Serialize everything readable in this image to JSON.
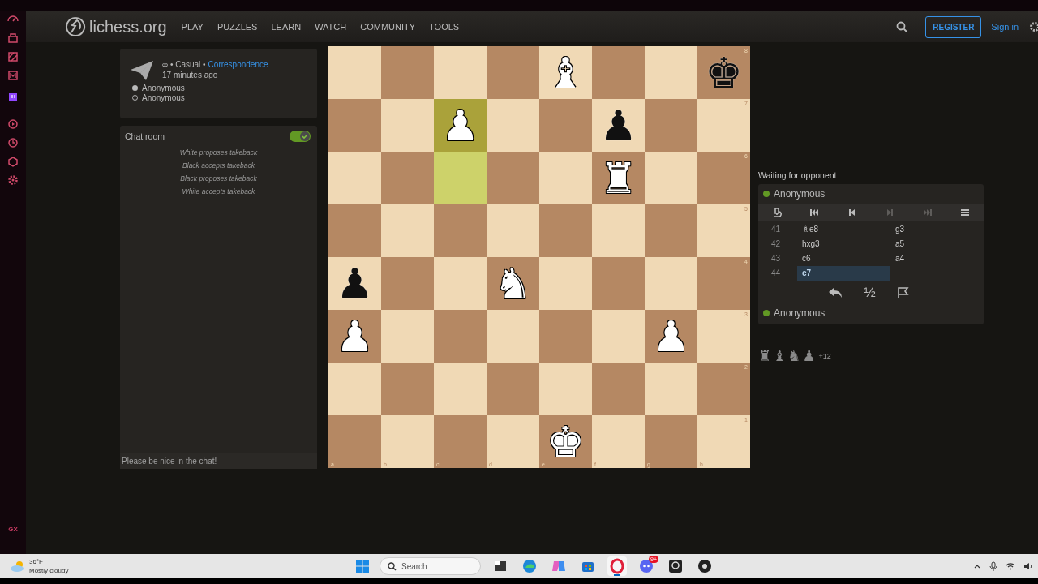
{
  "browser_sidebar": {
    "label": "GX",
    "more": "..."
  },
  "header": {
    "logo": "lichess.org",
    "nav": [
      "PLAY",
      "PUZZLES",
      "LEARN",
      "WATCH",
      "COMMUNITY",
      "TOOLS"
    ],
    "register": "REGISTER",
    "sign_in": "Sign in"
  },
  "game_info": {
    "speed": "∞ • Casual •",
    "variant_link": "Correspondence",
    "time": "17 minutes ago",
    "players": [
      {
        "name": "Anonymous",
        "kind": "white"
      },
      {
        "name": "Anonymous",
        "kind": "black"
      }
    ]
  },
  "chat": {
    "title": "Chat room",
    "on": true,
    "messages": [
      "White proposes takeback",
      "Black accepts takeback",
      "Black proposes takeback",
      "White accepts takeback"
    ],
    "placeholder": "Please be nice in the chat!"
  },
  "board": {
    "files": [
      "a",
      "b",
      "c",
      "d",
      "e",
      "f",
      "g",
      "h"
    ],
    "ranks": [
      "8",
      "7",
      "6",
      "5",
      "4",
      "3",
      "2",
      "1"
    ],
    "rows": [
      [
        {
          "highlighted": false
        },
        {
          "highlighted": false
        },
        {
          "highlighted": false
        },
        {
          "highlighted": false
        },
        {
          "highlighted": false,
          "piece": "♝",
          "kind": "white"
        },
        {
          "highlighted": false
        },
        {
          "highlighted": false
        },
        {
          "highlighted": false,
          "piece": "♚",
          "kind": "black"
        }
      ],
      [
        {
          "highlighted": false
        },
        {
          "highlighted": false
        },
        {
          "highlighted": true,
          "piece": "♟",
          "kind": "white"
        },
        {
          "highlighted": false
        },
        {
          "highlighted": false
        },
        {
          "highlighted": false,
          "piece": "♟",
          "kind": "black"
        },
        {
          "highlighted": false
        },
        {
          "highlighted": false
        }
      ],
      [
        {
          "highlighted": false
        },
        {
          "highlighted": false
        },
        {
          "highlighted": true
        },
        {
          "highlighted": false
        },
        {
          "highlighted": false
        },
        {
          "highlighted": false,
          "piece": "♜",
          "kind": "white"
        },
        {
          "highlighted": false
        },
        {
          "highlighted": false
        }
      ],
      [
        {
          "highlighted": false
        },
        {
          "highlighted": false
        },
        {
          "highlighted": false
        },
        {
          "highlighted": false
        },
        {
          "highlighted": false
        },
        {
          "highlighted": false
        },
        {
          "highlighted": false
        },
        {
          "highlighted": false
        }
      ],
      [
        {
          "highlighted": false,
          "piece": "♟",
          "kind": "black"
        },
        {
          "highlighted": false
        },
        {
          "highlighted": false
        },
        {
          "highlighted": false,
          "piece": "♞",
          "kind": "white"
        },
        {
          "highlighted": false
        },
        {
          "highlighted": false
        },
        {
          "highlighted": false
        },
        {
          "highlighted": false
        }
      ],
      [
        {
          "highlighted": false,
          "piece": "♟",
          "kind": "white"
        },
        {
          "highlighted": false
        },
        {
          "highlighted": false
        },
        {
          "highlighted": false
        },
        {
          "highlighted": false
        },
        {
          "highlighted": false
        },
        {
          "highlighted": false,
          "piece": "♟",
          "kind": "white"
        },
        {
          "highlighted": false
        }
      ],
      [
        {
          "highlighted": false
        },
        {
          "highlighted": false
        },
        {
          "highlighted": false
        },
        {
          "highlighted": false
        },
        {
          "highlighted": false
        },
        {
          "highlighted": false
        },
        {
          "highlighted": false
        },
        {
          "highlighted": false
        }
      ],
      [
        {
          "highlighted": false
        },
        {
          "highlighted": false
        },
        {
          "highlighted": false
        },
        {
          "highlighted": false
        },
        {
          "highlighted": false,
          "piece": "♚",
          "kind": "white"
        },
        {
          "highlighted": false
        },
        {
          "highlighted": false
        },
        {
          "highlighted": false
        }
      ]
    ]
  },
  "status": "Waiting for opponent",
  "top_player": {
    "name": "Anonymous",
    "online": true
  },
  "controls": [
    {
      "kind": "analysis",
      "disabled": false
    },
    {
      "kind": "first",
      "disabled": false
    },
    {
      "kind": "prev",
      "disabled": false
    },
    {
      "kind": "next",
      "disabled": true
    },
    {
      "kind": "last",
      "disabled": true
    },
    {
      "kind": "menu",
      "disabled": false
    }
  ],
  "moves": [
    {
      "number": "41",
      "white": {
        "san": "♗e8",
        "selected": false
      },
      "black": {
        "san": "g3",
        "selected": false
      }
    },
    {
      "number": "42",
      "white": {
        "san": "hxg3",
        "selected": false
      },
      "black": {
        "san": "a5",
        "selected": false
      }
    },
    {
      "number": "43",
      "white": {
        "san": "c6",
        "selected": false
      },
      "black": {
        "san": "a4",
        "selected": false
      }
    },
    {
      "number": "44",
      "white": {
        "san": "c7",
        "selected": true
      }
    }
  ],
  "actions": [
    {
      "kind": "takeback"
    },
    {
      "kind": "draw",
      "label": "½"
    },
    {
      "kind": "resign"
    }
  ],
  "bottom_player": {
    "name": "Anonymous",
    "online": true
  },
  "material": {
    "pieces": [
      "♜",
      "♝",
      "♞",
      "♟"
    ],
    "score": "+12"
  },
  "taskbar": {
    "temperature": "36°F",
    "weather": "Mostly cloudy",
    "search_placeholder": "Search",
    "apps": [
      {
        "kind": "files",
        "active": false
      },
      {
        "kind": "browser",
        "active": false
      },
      {
        "kind": "assistant",
        "active": false
      },
      {
        "kind": "store",
        "active": false
      },
      {
        "kind": "opera",
        "active": true
      },
      {
        "kind": "chat",
        "active": false,
        "badge": "9+"
      },
      {
        "kind": "webcam",
        "active": false
      },
      {
        "kind": "recorder",
        "active": false
      }
    ]
  }
}
